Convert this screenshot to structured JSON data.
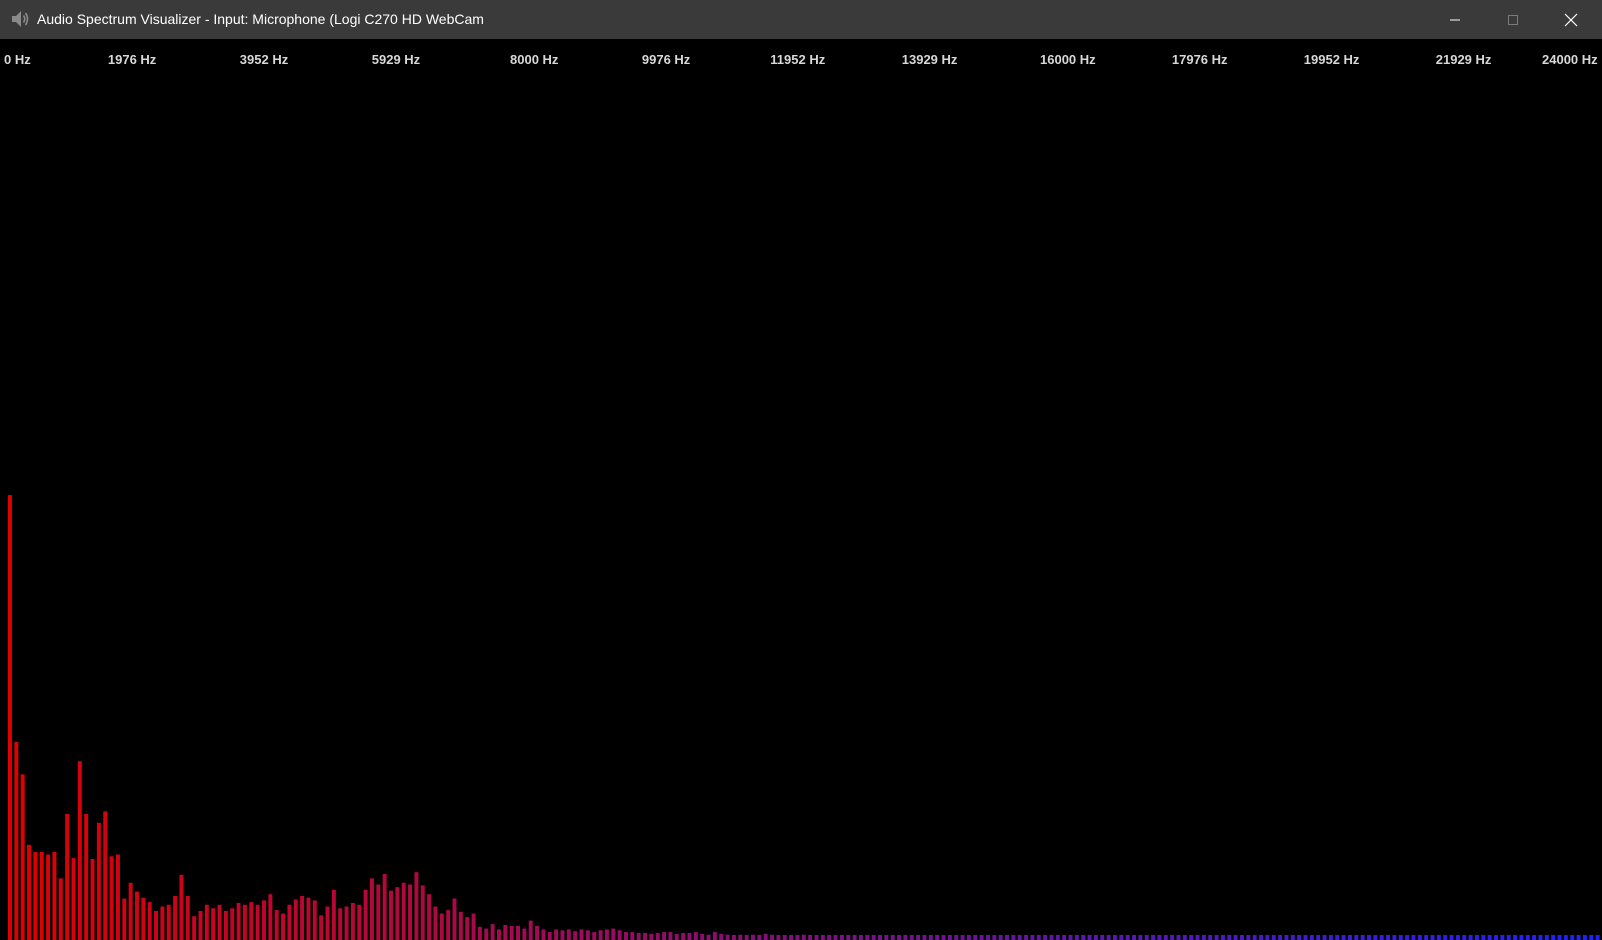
{
  "window": {
    "title": "Audio Spectrum Visualizer - Input: Microphone (Logi C270 HD WebCam",
    "app_icon": "speaker-icon",
    "controls": {
      "minimize_icon": "minimize-icon",
      "maximize_icon": "maximize-icon",
      "close_icon": "close-icon"
    },
    "titlebar_color": "#3a3a3a",
    "background_color": "#000000"
  },
  "chart_data": {
    "type": "bar",
    "title": "",
    "xlabel": "",
    "ylabel": "",
    "x_unit": "Hz",
    "xlim": [
      0,
      24000
    ],
    "ylim": [
      0,
      1
    ],
    "grid": false,
    "legend": "none",
    "x_tick_labels": [
      "0 Hz",
      "1976 Hz",
      "3952 Hz",
      "5929 Hz",
      "8000 Hz",
      "9976 Hz",
      "11952 Hz",
      "13929 Hz",
      "16000 Hz",
      "17976 Hz",
      "19952 Hz",
      "21929 Hz",
      "24000 Hz"
    ],
    "x_tick_values": [
      0,
      1976,
      3952,
      5929,
      8000,
      9976,
      11952,
      13929,
      16000,
      17976,
      19952,
      21929,
      24000
    ],
    "color_low": "#e00000",
    "color_high": "#2020ff",
    "bin_width_hz": 93.75,
    "magnitudes": [
      0.505,
      0.225,
      0.188,
      0.108,
      0.1,
      0.1,
      0.097,
      0.1,
      0.07,
      0.143,
      0.093,
      0.203,
      0.143,
      0.092,
      0.133,
      0.146,
      0.095,
      0.097,
      0.047,
      0.065,
      0.055,
      0.048,
      0.043,
      0.033,
      0.038,
      0.04,
      0.05,
      0.074,
      0.05,
      0.027,
      0.033,
      0.04,
      0.036,
      0.04,
      0.033,
      0.036,
      0.042,
      0.04,
      0.043,
      0.04,
      0.045,
      0.052,
      0.034,
      0.03,
      0.04,
      0.046,
      0.05,
      0.048,
      0.045,
      0.028,
      0.038,
      0.057,
      0.036,
      0.038,
      0.042,
      0.04,
      0.057,
      0.07,
      0.063,
      0.075,
      0.056,
      0.06,
      0.065,
      0.063,
      0.077,
      0.062,
      0.052,
      0.038,
      0.03,
      0.034,
      0.047,
      0.032,
      0.026,
      0.03,
      0.015,
      0.013,
      0.018,
      0.012,
      0.017,
      0.016,
      0.016,
      0.013,
      0.022,
      0.016,
      0.012,
      0.009,
      0.012,
      0.011,
      0.012,
      0.01,
      0.012,
      0.011,
      0.009,
      0.011,
      0.012,
      0.013,
      0.011,
      0.009,
      0.009,
      0.008,
      0.008,
      0.007,
      0.008,
      0.009,
      0.009,
      0.007,
      0.008,
      0.008,
      0.009,
      0.007,
      0.006,
      0.009,
      0.007,
      0.006,
      0.005,
      0.006,
      0.005,
      0.006,
      0.005,
      0.007,
      0.006,
      0.005,
      0.005,
      0.005,
      0.005,
      0.006,
      0.005,
      0.004,
      0.005,
      0.004,
      0.005,
      0.004,
      0.004,
      0.005,
      0.004,
      0.004,
      0.005,
      0.004,
      0.004,
      0.005,
      0.004,
      0.004,
      0.005,
      0.004,
      0.004,
      0.004,
      0.005,
      0.004,
      0.004,
      0.004,
      0.005,
      0.004,
      0.004,
      0.004,
      0.005,
      0.004,
      0.004,
      0.005,
      0.004,
      0.004,
      0.004,
      0.005,
      0.004,
      0.004,
      0.004,
      0.005,
      0.004,
      0.004,
      0.005,
      0.004,
      0.004,
      0.004,
      0.004,
      0.005,
      0.004,
      0.004,
      0.004,
      0.004,
      0.005,
      0.004,
      0.004,
      0.005,
      0.004,
      0.004,
      0.005,
      0.004,
      0.004,
      0.004,
      0.005,
      0.004,
      0.004,
      0.004,
      0.004,
      0.005,
      0.004,
      0.004,
      0.004,
      0.005,
      0.004,
      0.004,
      0.004,
      0.004,
      0.005,
      0.004,
      0.004,
      0.005,
      0.004,
      0.004,
      0.004,
      0.005,
      0.004,
      0.004,
      0.005,
      0.004,
      0.004,
      0.004,
      0.005,
      0.004,
      0.004,
      0.005,
      0.004,
      0.004,
      0.004,
      0.005,
      0.004,
      0.004,
      0.005,
      0.004,
      0.004,
      0.004,
      0.004,
      0.005,
      0.004,
      0.004,
      0.005,
      0.004,
      0.004,
      0.004,
      0.004,
      0.005,
      0.004,
      0.004,
      0.005,
      0.004,
      0.004,
      0.004,
      0.005,
      0.004,
      0.004,
      0.004,
      0.005
    ]
  }
}
